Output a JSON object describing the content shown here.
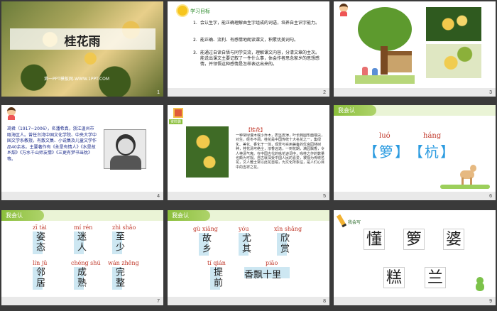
{
  "slides": [
    {
      "num": "1",
      "title": "桂花雨",
      "footer": "第一PPT模板网-WWW.1PPT.COM"
    },
    {
      "num": "2",
      "header": "学习目标",
      "goals": [
        {
          "n": "1.",
          "text": "会认生字，能正确理解由生字组成的词语，培养自主识字能力。"
        },
        {
          "n": "2.",
          "text": "能正确、流利、有感情地朗读课文，积累优美词句。"
        },
        {
          "n": "3.",
          "text": "能通过自读自悟与同学交流，理解课文内容，分清文章的主次。能说出课文主要记叙了一件什么事，体会作者思念家乡的思想感情，并领悟这种感情是怎样表达出来的。"
        }
      ]
    },
    {
      "num": "3"
    },
    {
      "num": "4",
      "bio": "琦君（1917~2006），名潘希真，浙江温州市瓯海区人。曾任台湾中国文化学院、中央大学中国文学系教授。有散文集、小说集及儿童文学作品40余本。主要著作有《永是有情人》《水是故乡甜》《万水千山师友情》《三更有梦书当枕》等。"
    },
    {
      "num": "5",
      "tag": "资料袋",
      "heading": "【桂花】",
      "body": "一种常绿灌木或小乔木，质坚皮薄，叶长椭圆形面端尖，对生，经冬不凋。桂花是中国传统十大名花之一，集绿化、美化、香化于一体，观赏与实用兼备的优良园林树种，桂花清可绝尘，浓香远逸，一到花期，满园飘香，令人神清气爽。在中国古代的咏花诗词中，咏桂之作的数量也颇为可观。自古就深受中国人民的喜爱，被视为传统名花，文人雅士常以此花自喻，为文化所象征，是人们心目中的吉祥之花。"
    },
    {
      "num": "6",
      "label": "我会认",
      "chars": [
        {
          "py": "luó",
          "hz": "箩"
        },
        {
          "py": "háng",
          "hz": "杭"
        }
      ],
      "brk_l": "【",
      "brk_r": "】"
    },
    {
      "num": "7",
      "label": "我会认",
      "words": [
        {
          "py": "zī tài",
          "hz": "姿态"
        },
        {
          "py": "mí rén",
          "hz": "迷人"
        },
        {
          "py": "zhì shǎo",
          "hz": "至少"
        },
        {
          "py": "lín jū",
          "hz": "邻居"
        },
        {
          "py": "chéng shú",
          "hz": "成熟"
        },
        {
          "py": "wán zhěng",
          "hz": "完整"
        }
      ]
    },
    {
      "num": "8",
      "label": "我会认",
      "words": [
        {
          "py": "gù xiāng",
          "hz": "故乡"
        },
        {
          "py": "yóu",
          "hz": "尤其"
        },
        {
          "py": "xīn shǎng",
          "hz": "欣赏"
        },
        {
          "py": "tí qián",
          "hz": "提前"
        },
        {
          "py": "piāo",
          "hz": "香飘十里"
        }
      ]
    },
    {
      "num": "9",
      "label": "我会写",
      "chars": [
        "懂",
        "箩",
        "婆",
        "糕",
        "兰"
      ]
    }
  ],
  "colors": {
    "accent": "#8bbf3c",
    "pinyin": "#c0392b",
    "bracket": "#2b9be0",
    "bg": "#3a3a3a"
  },
  "icons": [
    "sun-icon",
    "boy-icon",
    "book-icon",
    "pencil-icon",
    "dinosaur-icon"
  ]
}
